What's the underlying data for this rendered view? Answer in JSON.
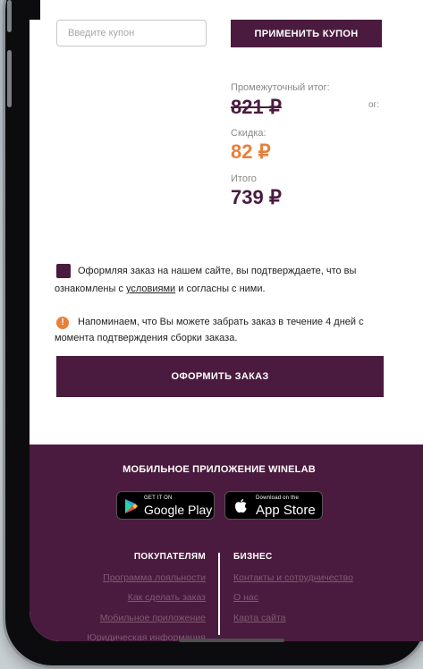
{
  "coupon": {
    "placeholder": "Введите купон",
    "apply_label": "ПРИМЕНИТЬ КУПОН"
  },
  "summary": {
    "subtotal_label": "Промежуточный итог:",
    "subtotal_value": "821 ₽",
    "side_note": "ог:",
    "discount_label": "Скидка:",
    "discount_value": "82 ₽",
    "total_label": "Итого",
    "total_value": "739 ₽"
  },
  "consent": {
    "text_before": "Оформляя заказ на нашем сайте, вы подтверждаете, что вы ознакомлены с ",
    "link": "условиями",
    "text_after": " и согласны с ними."
  },
  "notice": {
    "icon_glyph": "!",
    "text": "Напоминаем, что Вы можете забрать заказ в течение 4 дней с момента подтверждения сборки заказа."
  },
  "order_button": "ОФОРМИТЬ ЗАКАЗ",
  "footer": {
    "app_title": "МОБИЛЬНОЕ ПРИЛОЖЕНИЕ WINELAB",
    "google_play": {
      "small": "GET IT ON",
      "big": "Google Play"
    },
    "app_store": {
      "small": "Download on the",
      "big": "App Store"
    },
    "buyers": {
      "heading": "ПОКУПАТЕЛЯМ",
      "links": [
        "Программа лояльности",
        "Как сделать заказ",
        "Мобильное приложение",
        "Юридическая информация"
      ]
    },
    "business": {
      "heading": "БИЗНЕС",
      "links": [
        "Контакты и сотрудничество",
        "О нас",
        "Карта сайта"
      ]
    }
  },
  "colors": {
    "brand": "#4a1b3e",
    "discount": "#e8803a",
    "footer_link": "#7e5a74"
  }
}
